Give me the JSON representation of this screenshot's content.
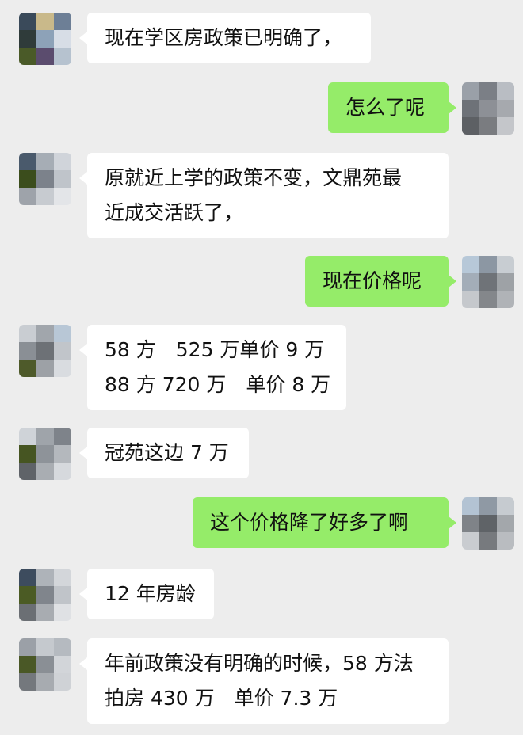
{
  "messages": [
    {
      "side": "in",
      "lines": [
        "现在学区房政策已明确了，"
      ]
    },
    {
      "side": "out",
      "lines": [
        "怎么了呢"
      ]
    },
    {
      "side": "in",
      "lines": [
        "原就近上学的政策不变，文鼎苑最",
        "近成交活跃了，"
      ]
    },
    {
      "side": "out",
      "lines": [
        "现在价格呢"
      ]
    },
    {
      "side": "in",
      "lines": [
        "58 方　525 万单价 9 万",
        "88 方 720 万　单价 8 万"
      ]
    },
    {
      "side": "in",
      "lines": [
        "冠苑这边 7 万"
      ]
    },
    {
      "side": "out",
      "lines": [
        "这个价格降了好多了啊"
      ]
    },
    {
      "side": "in",
      "lines": [
        "12 年房龄"
      ]
    },
    {
      "side": "in",
      "lines": [
        "年前政策没有明确的时候，58 方法",
        "拍房 430 万　单价 7.3 万"
      ]
    }
  ]
}
